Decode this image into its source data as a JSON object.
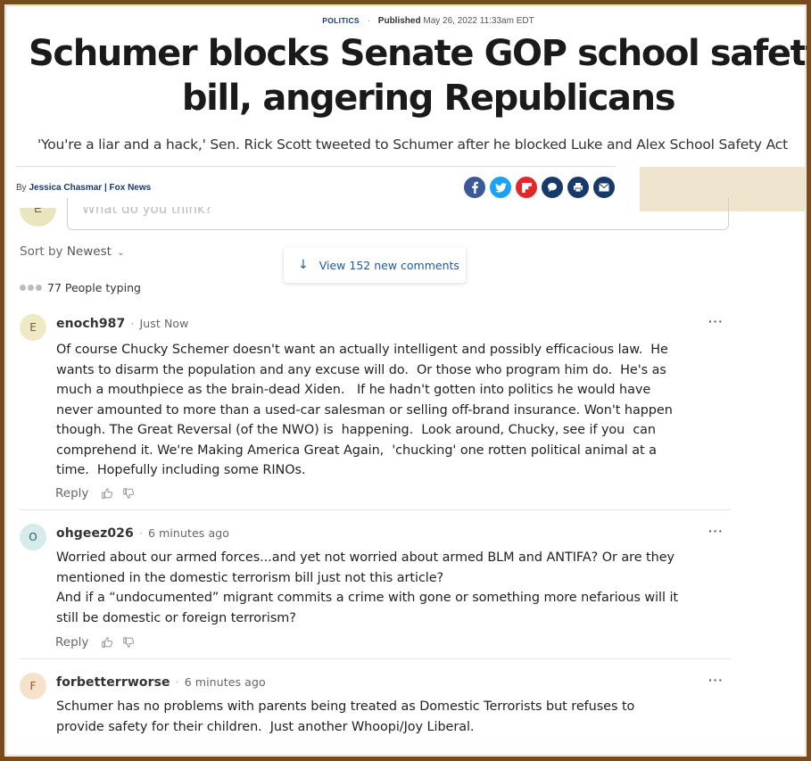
{
  "article": {
    "category": "POLITICS",
    "published_label": "Published",
    "published_date": "May 26, 2022 11:33am EDT",
    "headline": "Schumer blocks Senate GOP school safety bill, angering Republicans",
    "subhead": "'You're a liar and a hack,' Sen. Rick Scott tweeted to Schumer after he blocked Luke and Alex School Safety Act",
    "by_prefix": "By",
    "author": "Jessica Chasmar | Fox News"
  },
  "share": {
    "icons": [
      "facebook-icon",
      "twitter-icon",
      "flipboard-icon",
      "comments-icon",
      "print-icon",
      "email-icon"
    ],
    "colors": [
      "#3b5998",
      "#1da1f2",
      "#e12828",
      "#183a6a",
      "#183a6a",
      "#183a6a"
    ]
  },
  "composer": {
    "avatar_letter": "E",
    "placeholder": "What do you think?"
  },
  "comments_bar": {
    "sort_prefix": "Sort by",
    "sort_value": "Newest",
    "new_comments": "View 152 new comments",
    "typing": "77 People typing"
  },
  "comments": [
    {
      "avatar": "E",
      "avatar_color": "#eeeac5",
      "name": "enoch987",
      "time": "Just Now",
      "body": "Of course Chucky Schemer doesn't want an actually intelligent and possibly efficacious law.  He wants to disarm the population and any excuse will do.  Or those who program him do.  He's as much a mouthpiece as the brain-dead Xiden.   If he hadn't gotten into politics he would have never amounted to more than a used-car salesman or selling off-brand insurance. Won't happen though. The Great Reversal (of the NWO) is  happening.  Look around, Chucky, see if you  can comprehend it. We're Making America Great Again,  'chucking' one rotten political animal at a time.  Hopefully including some RINOs.",
      "reply": "Reply"
    },
    {
      "avatar": "O",
      "avatar_color": "#d6ecec",
      "name": "ohgeez026",
      "time": "6 minutes ago",
      "body": "Worried about our armed forces...and yet not worried about armed BLM and ANTIFA? Or are they mentioned in the domestic terrorism bill just not this article?\nAnd if a “undocumented” migrant commits a crime with gone or something more nefarious will it still be domestic or foreign terrorism?",
      "reply": "Reply"
    },
    {
      "avatar": "F",
      "avatar_color": "#f6e1cb",
      "name": "forbetterrworse",
      "time": "6 minutes ago",
      "body": "Schumer has no problems with parents being treated as Domestic Terrorists but refuses to provide safety for their children.  Just another Whoopi/Joy Liberal.",
      "reply": "Reply"
    }
  ]
}
